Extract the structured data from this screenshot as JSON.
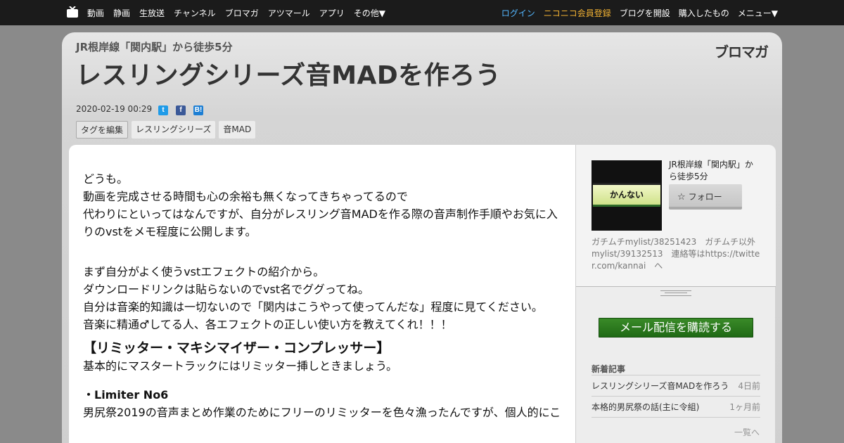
{
  "nav": {
    "left": [
      "動画",
      "静画",
      "生放送",
      "チャンネル",
      "ブロマガ",
      "アツマール",
      "アプリ",
      "その他▼"
    ],
    "login": "ログイン",
    "register": "ニコニコ会員登録",
    "open_blog": "ブログを開設",
    "purchased": "購入したもの",
    "menu": "メニュー▼"
  },
  "header": {
    "blog_name": "JR根岸線「関内駅」から徒歩5分",
    "title": "レスリングシリーズ音MADを作ろう",
    "brand": "ブロマガ",
    "date": "2020-02-19 00:29",
    "share": {
      "twitter": "t",
      "facebook": "f",
      "hatena": "B!"
    },
    "tags": [
      "タグを編集",
      "レスリングシリーズ",
      "音MAD"
    ]
  },
  "article": {
    "p1": "どうも。\n動画を完成させる時間も心の余裕も無くなってきちゃってるので\n代わりにといってはなんですが、自分がレスリング音MADを作る際の音声制作手順やお気に入りのvstをメモ程度に公開します。",
    "p2": "まず自分がよく使うvstエフェクトの紹介から。\nダウンロードリンクは貼らないのでvst名でググってね。\n自分は音楽的知識は一切ないので「関内はこうやって使ってんだな」程度に見てください。\n音楽に精通♂してる人、各エフェクトの正しい使い方を教えてくれ！！！",
    "h1": "【リミッター・マキシマイザー・コンプレッサー】",
    "p3": "基本的にマスタートラックにはリミッター挿しときましょう。",
    "h2": "・Limiter No6",
    "p4": "男尻祭2019の音声まとめ作業のためにフリーのリミッターを色々漁ったんですが、個人的にこ"
  },
  "sidebar": {
    "thumb_text": "かんない",
    "profile_name": "JR根岸線「関内駅」から徒歩5分",
    "follow": "フォロー",
    "description": "ガチムチmylist/38251423　ガチムチ以外mylist/39132513　連絡等はhttps://twitter.com/kannai　へ",
    "subscribe": "メール配信を購読する",
    "recent_title": "新着記事",
    "recent": [
      {
        "title": "レスリングシリーズ音MADを作ろう",
        "when": "4日前"
      },
      {
        "title": "本格的男尻祭の話(主に令組)",
        "when": "1ヶ月前"
      }
    ],
    "more": "一覧へ"
  }
}
